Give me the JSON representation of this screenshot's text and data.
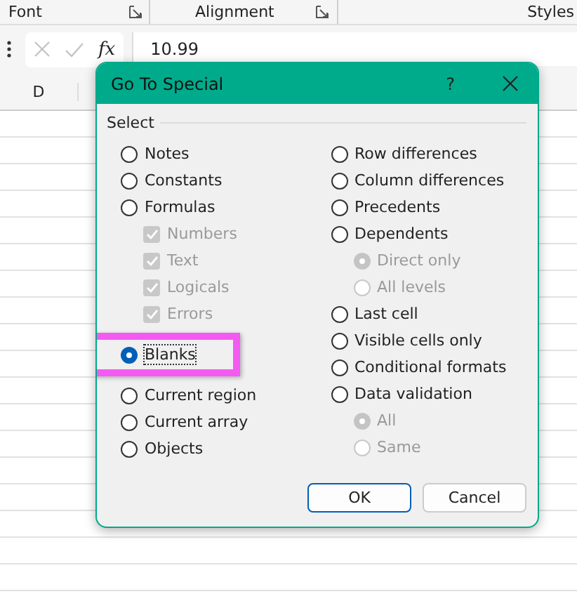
{
  "ribbon": {
    "groups": [
      {
        "label": "Font",
        "launcher": true
      },
      {
        "label": "Alignment",
        "launcher": true
      },
      {
        "label": "Styles",
        "launcher": false
      }
    ]
  },
  "formula_bar": {
    "fx": "fx",
    "value": "10.99"
  },
  "column_headers": [
    "D"
  ],
  "dialog": {
    "title": "Go To Special",
    "help": "?",
    "group_label": "Select",
    "columns": [
      [
        {
          "kind": "radio",
          "label": "Notes",
          "selected": false,
          "highlighted": false
        },
        {
          "kind": "radio",
          "label": "Constants",
          "selected": false,
          "highlighted": false
        },
        {
          "kind": "radio",
          "label": "Formulas",
          "selected": false,
          "highlighted": false,
          "children": [
            {
              "kind": "check",
              "label": "Numbers",
              "checked": true,
              "disabled": true
            },
            {
              "kind": "check",
              "label": "Text",
              "checked": true,
              "disabled": true
            },
            {
              "kind": "check",
              "label": "Logicals",
              "checked": true,
              "disabled": true
            },
            {
              "kind": "check",
              "label": "Errors",
              "checked": true,
              "disabled": true
            }
          ]
        },
        {
          "kind": "radio",
          "label": "Blanks",
          "selected": true,
          "highlighted": true
        },
        {
          "kind": "radio",
          "label": "Current region",
          "selected": false,
          "highlighted": false
        },
        {
          "kind": "radio",
          "label": "Current array",
          "selected": false,
          "highlighted": false
        },
        {
          "kind": "radio",
          "label": "Objects",
          "selected": false,
          "highlighted": false
        }
      ],
      [
        {
          "kind": "radio",
          "label": "Row differences",
          "selected": false,
          "highlighted": false
        },
        {
          "kind": "radio",
          "label": "Column differences",
          "selected": false,
          "highlighted": false
        },
        {
          "kind": "radio",
          "label": "Precedents",
          "selected": false,
          "highlighted": false
        },
        {
          "kind": "radio",
          "label": "Dependents",
          "selected": false,
          "highlighted": false,
          "children": [
            {
              "kind": "radio",
              "label": "Direct only",
              "selected": true,
              "disabled": true
            },
            {
              "kind": "radio",
              "label": "All levels",
              "selected": false,
              "disabled": true
            }
          ]
        },
        {
          "kind": "radio",
          "label": "Last cell",
          "selected": false,
          "highlighted": false
        },
        {
          "kind": "radio",
          "label": "Visible cells only",
          "selected": false,
          "highlighted": false
        },
        {
          "kind": "radio",
          "label": "Conditional formats",
          "selected": false,
          "highlighted": false
        },
        {
          "kind": "radio",
          "label": "Data validation",
          "selected": false,
          "highlighted": false,
          "children": [
            {
              "kind": "radio",
              "label": "All",
              "selected": true,
              "disabled": true
            },
            {
              "kind": "radio",
              "label": "Same",
              "selected": false,
              "disabled": true
            }
          ]
        }
      ]
    ],
    "buttons": [
      {
        "label": "OK",
        "default": true
      },
      {
        "label": "Cancel",
        "default": false
      }
    ]
  }
}
